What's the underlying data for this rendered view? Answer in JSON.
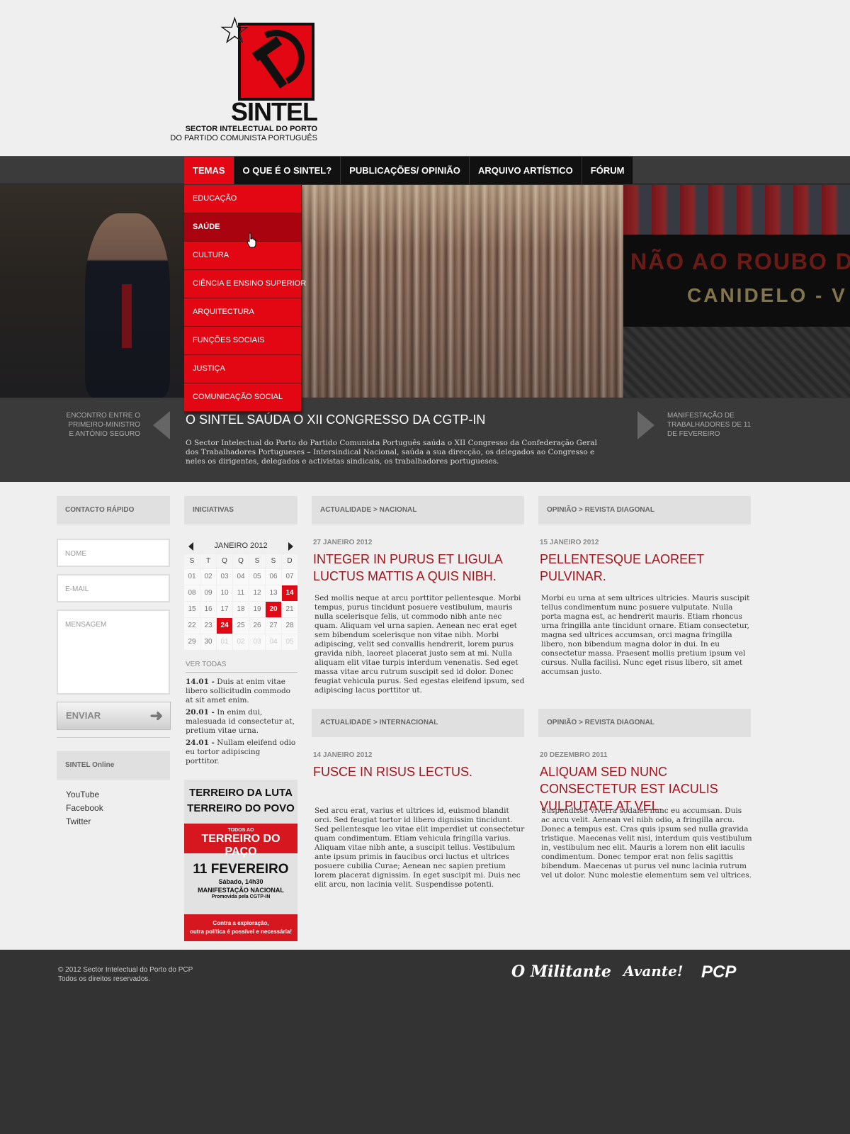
{
  "logo": {
    "title": "SINTEL",
    "subtitle_line1": "SECTOR INTELECTUAL DO PORTO",
    "subtitle_line2": "DO PARTIDO COMUNISTA PORTUGUÊS"
  },
  "nav": {
    "items": [
      "TEMAS",
      "O QUE É O SINTEL?",
      "PUBLICAÇÕES/ OPINIÃO",
      "ARQUIVO ARTÍSTICO",
      "FÓRUM"
    ],
    "active": "TEMAS"
  },
  "dropdown": {
    "items": [
      "EDUCAÇÃO",
      "SAÚDE",
      "CULTURA",
      "CIÊNCIA E ENSINO SUPERIOR",
      "ARQUITECTURA",
      "FUNÇÕES SOCIAIS",
      "JUSTIÇA",
      "COMUNICAÇÃO SOCIAL"
    ],
    "hovered": "SAÚDE"
  },
  "hero": {
    "banner_line1": "NÃO AO ROUBO DO",
    "banner_line2": "CANIDELO - V"
  },
  "slider": {
    "prev_label": "ENCONTRO ENTRE O PRIMEIRO-MINISTRO E ANTÓNIO SEGURO",
    "next_label": "MANIFESTAÇÃO DE TRABALHADORES DE 11 DE FEVEREIRO",
    "title": "O SINTEL SAÚDA O XII CONGRESSO DA CGTP-IN",
    "text": "O Sector Intelectual do Porto do Partido Comunista Português saúda o XII Congresso da Confederação Geral dos Trabalhadores Portugueses – Intersindical Nacional, saúda a sua direcção, os delegados ao Congresso e neles os dirigentes, delegados e activistas sindicais, os trabalhadores portugueses."
  },
  "contact": {
    "heading": "CONTACTO RÁPIDO",
    "name_placeholder": "NOME",
    "email_placeholder": "E-MAIL",
    "message_placeholder": "MENSAGEM",
    "send_label": "ENVIAR"
  },
  "online": {
    "heading": "SINTEL Online",
    "links": [
      "YouTube",
      "Facebook",
      "Twitter"
    ]
  },
  "iniciativas": {
    "heading": "INICIATIVAS",
    "calendar": {
      "month": "JANEIRO 2012",
      "weekdays": [
        "S",
        "T",
        "Q",
        "Q",
        "S",
        "S",
        "D"
      ],
      "days": [
        [
          "01",
          "02",
          "03",
          "04",
          "05",
          "06",
          "07"
        ],
        [
          "08",
          "09",
          "10",
          "11",
          "12",
          "13",
          "14"
        ],
        [
          "15",
          "16",
          "17",
          "18",
          "19",
          "20",
          "21"
        ],
        [
          "22",
          "23",
          "24",
          "25",
          "26",
          "27",
          "28"
        ],
        [
          "29",
          "30",
          "01",
          "02",
          "03",
          "04",
          "05"
        ]
      ],
      "event_days": [
        "14",
        "20",
        "24"
      ]
    },
    "see_all": "VER TODAS",
    "events": [
      {
        "date": "14.01 -",
        "text": " Duis at enim vitae libero sollicitudin commodo at sit amet enim."
      },
      {
        "date": "20.01 -",
        "text": " In enim dui, malesuada id consectetur at, pretium vitae urna."
      },
      {
        "date": "24.01 -",
        "text": " Nullam eleifend odio eu tortor adipiscing porttitor."
      }
    ],
    "poster": {
      "line1": "TERREIRO DA LUTA",
      "line2": "TERREIRO DO POVO",
      "band_small": "TODOS AO",
      "band_big": "TERREIRO DO PAÇO",
      "date": "11 FEVEREIRO",
      "time": "Sábado, 14h30",
      "event": "MANIFESTAÇÃO NACIONAL",
      "promoted": "Promovida pela CGTP-IN",
      "footer_line1": "Contra a exploração,",
      "footer_line2": "outra política é possível e necessária!"
    }
  },
  "articles": [
    {
      "section": "ACTUALIDADE > NACIONAL",
      "date": "27 JANEIRO 2012",
      "title": "INTEGER IN PURUS ET LIGULA LUCTUS MATTIS A QUIS NIBH.",
      "body": "Sed mollis neque at arcu porttitor pellentesque. Morbi tempus, purus tincidunt posuere vestibulum, mauris nulla scelerisque felis, ut commodo nibh ante nec quam. Aliquam vel urna sapien. Aenean nec erat eget sem bibendum scelerisque non vitae nibh. Morbi adipiscing, velit sed convallis hendrerit, lorem purus gravida nibh, laoreet placerat justo sem at mi. Nulla aliquam elit vitae turpis interdum venenatis. Sed eget massa vitae arcu rutrum suscipit sed id dolor. Donec feugiat vehicula purus. Sed egestas eleifend ipsum, sed adipiscing lacus porttitor ut."
    },
    {
      "section": "OPINIÃO > REVISTA DIAGONAL",
      "date": "15 JANEIRO 2012",
      "title": "PELLENTESQUE LAOREET PULVINAR.",
      "body": "Morbi eu urna at sem ultrices ultricies. Mauris suscipit tellus condimentum nunc posuere vulputate. Nulla porta magna est, ac hendrerit mauris. Etiam rhoncus urna fringilla ante tincidunt ornare. Etiam consectetur, magna sed ultrices accumsan, orci magna fringilla libero, non bibendum magna dolor in dui. In eu consectetur massa. Praesent mollis pretium ipsum vel cursus. Nulla facilisi. Nunc eget risus libero, sit amet accumsan justo."
    },
    {
      "section": "ACTUALIDADE > INTERNACIONAL",
      "date": "14 JANEIRO 2012",
      "title": "FUSCE IN RISUS LECTUS.",
      "body": "Sed arcu erat, varius et ultrices id, euismod blandit orci. Sed feugiat tortor id libero dignissim tincidunt. Sed pellentesque leo vitae elit imperdiet ut consectetur quam condimentum. Etiam vehicula fringilla varius. Aliquam vitae nibh ante, a suscipit tellus. Vestibulum ante ipsum primis in faucibus orci luctus et ultrices posuere cubilia Curae; Aenean nec sapien pretium lorem placerat dignissim. In eget suscipit mi. Duis nec elit arcu, non lacinia velit. Suspendisse potenti."
    },
    {
      "section": "OPINIÃO > REVISTA DIAGONAL",
      "date": "20 DEZEMBRO 2011",
      "title": "ALIQUAM SED NUNC CONSECTETUR EST IACULIS VULPUTATE AT VEL.",
      "body": "Suspendisse viverra sodales nunc eu accumsan. Duis ac arcu velit. Aenean vel nibh odio, a fringilla arcu. Donec a tempus est. Cras quis ipsum sed nulla gravida tristique. Maecenas velit nisi, interdum quis vestibulum in, vestibulum nec elit. Mauris a lorem non elit iaculis condimentum. Donec tempor erat non felis sagittis bibendum. Maecenas ut purus vel nunc lacinia rutrum vel ut dolor. Nunc molestie elementum sem vel ultrices."
    }
  ],
  "footer": {
    "copyright_line1": "© 2012 Sector Intelectual do Porto do PCP",
    "copyright_line2": "Todos os direitos reservados.",
    "brands": [
      "O Militante",
      "Avante!",
      "PCP"
    ]
  },
  "colors": {
    "accent_red": "#e30613",
    "title_red": "#a3141c",
    "dark": "#333333"
  },
  "icons": [
    "star-icon",
    "hammer-sickle-icon",
    "hand-cursor-icon",
    "arrow-left-icon",
    "arrow-right-icon",
    "send-arrow-icon",
    "calendar-prev-icon",
    "calendar-next-icon"
  ]
}
